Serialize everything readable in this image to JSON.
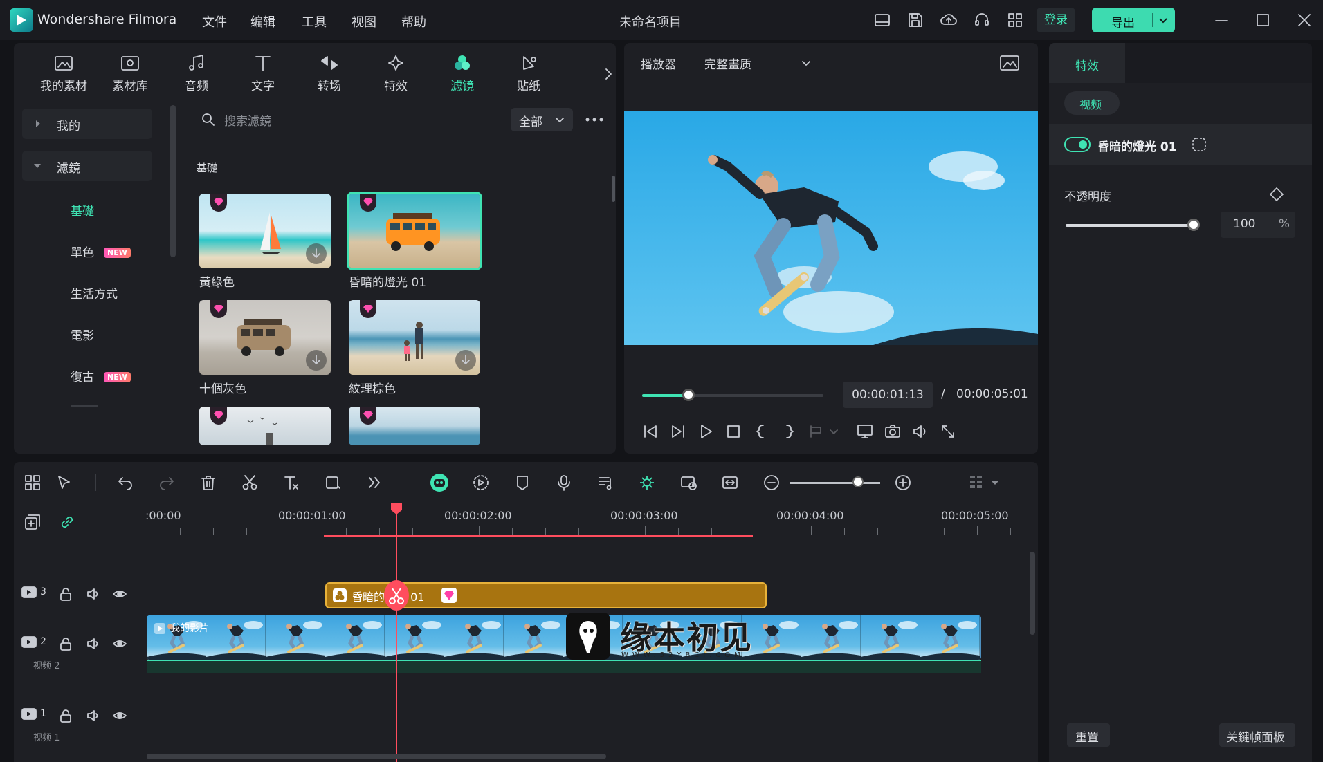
{
  "titlebar": {
    "app_name": "Wondershare Filmora",
    "menu": [
      "文件",
      "编辑",
      "工具",
      "视图",
      "帮助"
    ],
    "project_title": "未命名项目",
    "login_label": "登录",
    "export_label": "导出"
  },
  "category_tabs": [
    "我的素材",
    "素材库",
    "音频",
    "文字",
    "转场",
    "特效",
    "滤镜",
    "贴纸"
  ],
  "active_tab": "滤镜",
  "sidebar": {
    "mine_label": "我的",
    "filters_label": "濾鏡",
    "subitems": [
      {
        "label": "基礎",
        "active": true,
        "new": false
      },
      {
        "label": "單色",
        "active": false,
        "new": true
      },
      {
        "label": "生活方式",
        "active": false,
        "new": false
      },
      {
        "label": "電影",
        "active": false,
        "new": false
      },
      {
        "label": "復古",
        "active": false,
        "new": true
      }
    ],
    "new_badge": "NEW"
  },
  "search": {
    "placeholder": "搜索濾鏡",
    "filter_label": "全部"
  },
  "section_title": "基礎",
  "filter_items": [
    {
      "label": "黃綠色",
      "selected": false
    },
    {
      "label": "昏暗的燈光 01",
      "selected": true
    },
    {
      "label": "十個灰色",
      "selected": false
    },
    {
      "label": "紋理棕色",
      "selected": false
    }
  ],
  "player": {
    "label": "播放器",
    "quality": "完整畫质",
    "current_time": "00:00:01:13",
    "separator": "/",
    "total_time": "00:00:05:01",
    "progress": 0.26
  },
  "properties": {
    "tab_label": "特效",
    "video_chip": "视频",
    "effect_name": "昏暗的燈光 01",
    "opacity_label": "不透明度",
    "opacity_value": "100",
    "opacity_unit": "%",
    "reset_label": "重置",
    "keyframe_label": "关鍵帧面板"
  },
  "timeline": {
    "ruler_labels": [
      ":00:00",
      "00:00:01:00",
      "00:00:02:00",
      "00:00:03:00",
      "00:00:04:00",
      "00:00:05:00"
    ],
    "fx_clip_label": "昏暗的燈光 01",
    "video_clip_label": "我的影片",
    "tracks": [
      {
        "num": "3",
        "name": ""
      },
      {
        "num": "2",
        "name": "视频 2"
      },
      {
        "num": "1",
        "name": "视频 1"
      }
    ]
  },
  "watermark": {
    "text": "缘本初见",
    "url": "WWW.52YBCJ.COM"
  },
  "colors": {
    "accent": "#3fe3b3",
    "playhead": "#ff4d5e",
    "fx_clip": "#a87410",
    "background": "#131418"
  }
}
